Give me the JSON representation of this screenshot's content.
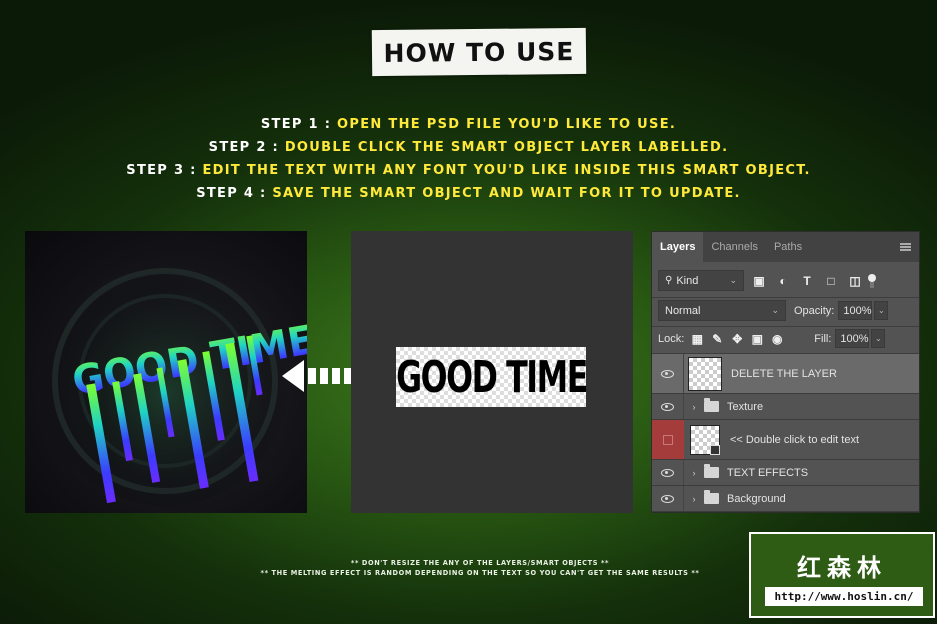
{
  "header": {
    "title": "HOW TO USE"
  },
  "steps": [
    {
      "label": "STEP 1 :",
      "text": "OPEN THE PSD FILE YOU'D LIKE TO USE."
    },
    {
      "label": "STEP 2 :",
      "text": "DOUBLE CLICK THE SMART OBJECT LAYER LABELLED."
    },
    {
      "label": "STEP 3 :",
      "text": "EDIT THE TEXT WITH ANY FONT YOU'D LIKE INSIDE THIS SMART OBJECT."
    },
    {
      "label": "STEP 4 :",
      "text": "SAVE THE SMART OBJECT AND WAIT FOR IT TO UPDATE."
    }
  ],
  "preview": {
    "art_text": "GOOD TIME",
    "smart_object_text": "GOOD TIME"
  },
  "layers_panel": {
    "tabs": [
      "Layers",
      "Channels",
      "Paths"
    ],
    "active_tab": "Layers",
    "filter_kind": "Kind",
    "filter_icons": [
      "image-filter-icon",
      "adjustment-filter-icon",
      "type-filter-icon",
      "shape-filter-icon",
      "smart-object-filter-icon"
    ],
    "blend_mode": "Normal",
    "opacity_label": "Opacity:",
    "opacity_value": "100%",
    "lock_label": "Lock:",
    "fill_label": "Fill:",
    "fill_value": "100%",
    "layers": [
      {
        "name": "DELETE THE LAYER",
        "type": "layer",
        "visible": true,
        "selected": true
      },
      {
        "name": "Texture",
        "type": "group",
        "visible": true,
        "selected": false
      },
      {
        "name": "<< Double click to edit text",
        "type": "smart-object",
        "visible": false,
        "selected": false
      },
      {
        "name": "TEXT EFFECTS",
        "type": "group",
        "visible": true,
        "selected": false
      },
      {
        "name": "Background",
        "type": "group",
        "visible": true,
        "selected": false
      }
    ]
  },
  "notes": [
    "** DON'T RESIZE THE ANY OF THE LAYERS/SMART OBJECTS **",
    "** THE MELTING EFFECT IS RANDOM DEPENDING ON THE TEXT SO YOU CAN'T GET THE SAME RESULTS **"
  ],
  "watermark": {
    "title": "红森林",
    "url": "http://www.hoslin.cn/"
  },
  "colors": {
    "step_label": "#ffffff",
    "step_text": "#ffe93a",
    "background": "#275612",
    "art_gradient": [
      "#7dff2e",
      "#1fd3c4",
      "#5a2cff"
    ]
  }
}
